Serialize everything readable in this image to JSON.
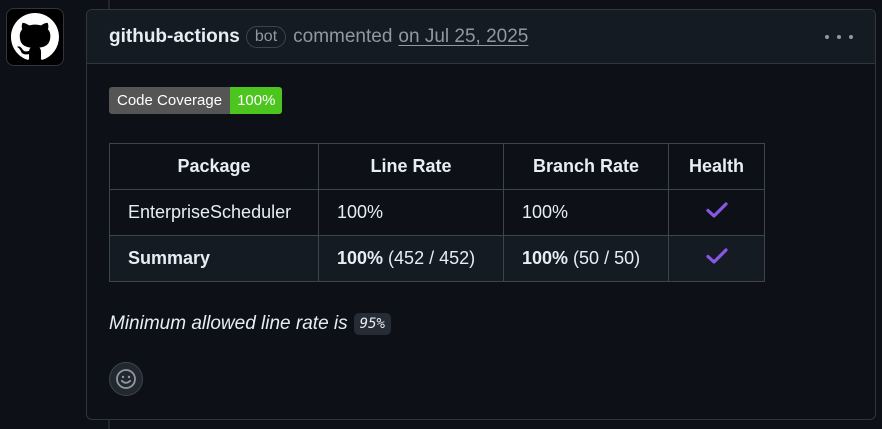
{
  "comment": {
    "author": "github-actions",
    "badge": "bot",
    "action": "commented",
    "date": "on Jul 25, 2025"
  },
  "coverage_badge": {
    "label": "Code Coverage",
    "value": "100%",
    "value_color": "#4cc61e"
  },
  "table": {
    "headers": [
      "Package",
      "Line Rate",
      "Branch Rate",
      "Health"
    ],
    "rows": [
      {
        "package": "EnterpriseScheduler",
        "line_rate": "100%",
        "branch_rate": "100%",
        "health": "check-icon"
      },
      {
        "package": "Summary",
        "line_rate_bold": "100%",
        "line_rate_detail": " (452 / 452)",
        "branch_rate_bold": "100%",
        "branch_rate_detail": " (50 / 50)",
        "health": "check-icon"
      }
    ]
  },
  "minimum_line": {
    "text": "Minimum allowed line rate is",
    "value": "95%"
  },
  "icons": {
    "avatar": "github-logo-icon",
    "more": "kebab-horizontal-icon",
    "reaction": "smiley-icon",
    "health": "check-icon"
  },
  "colors": {
    "check": "#8957e5",
    "background": "#0d1117"
  }
}
